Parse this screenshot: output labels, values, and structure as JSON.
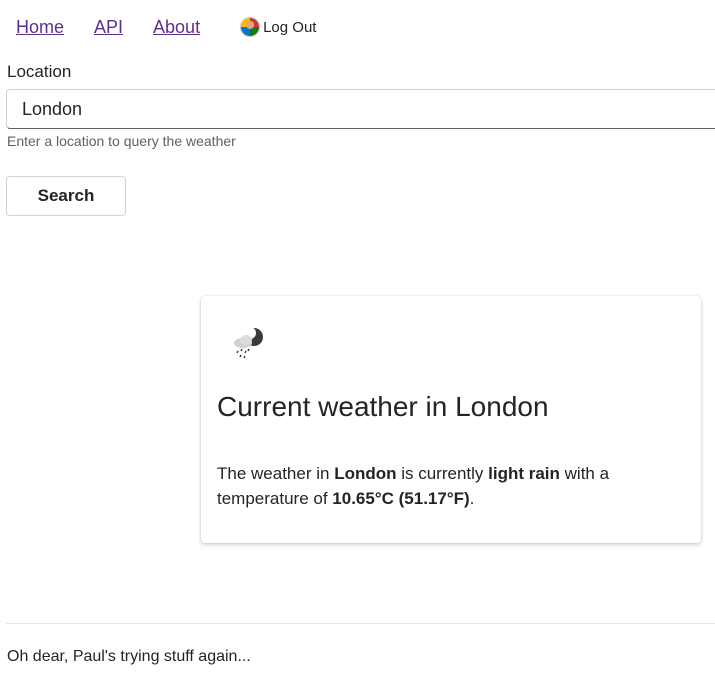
{
  "nav": {
    "home": "Home",
    "api": "API",
    "about": "About",
    "logout": "Log Out"
  },
  "search": {
    "label": "Location",
    "value": "London",
    "hint": "Enter a location to query the weather",
    "button": "Search"
  },
  "weather": {
    "icon": "light-rain-icon",
    "title": "Current weather in London",
    "text_prefix": "The weather in ",
    "location": "London",
    "text_mid": " is currently ",
    "condition": "light rain",
    "text_mid2": " with a temperature of ",
    "temperature": "10.65°C (51.17°F)",
    "text_suffix": "."
  },
  "footer": {
    "text": "Oh dear, Paul's trying stuff again..."
  },
  "colors": {
    "link": "#5c2e91",
    "text": "#242424",
    "hint": "#616161"
  }
}
